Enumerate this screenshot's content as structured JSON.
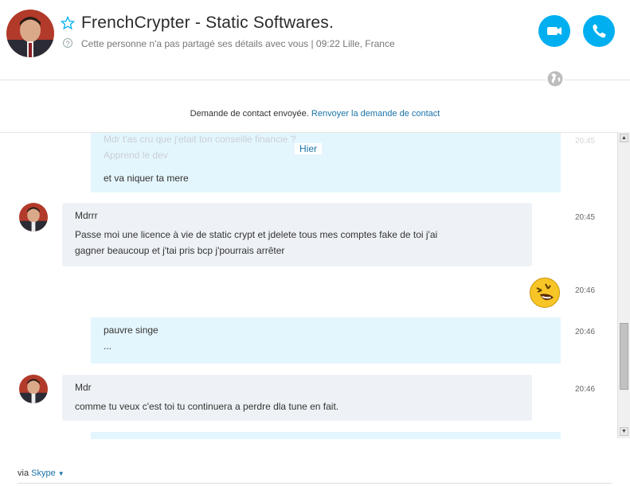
{
  "header": {
    "contact_name": "FrenchCrypter - Static Softwares.",
    "status_text": "Cette personne n'a pas partagé ses détails avec vous  |  09:22 Lille, France",
    "help_icon": "?"
  },
  "notice": {
    "text": "Demande de contact envoyée.",
    "link": "Renvoyer la demande de contact"
  },
  "conversation": {
    "faded_text_1": "Mdr t'as cru que j'etait ton conseille financie ?",
    "faded_text_2": "Apprend le dev",
    "faded_time": "20:45",
    "day_divider": "Hier",
    "messages": [
      {
        "from": "me",
        "lines": [
          "et va niquer ta mere"
        ],
        "time": ""
      },
      {
        "from": "them",
        "lines": [
          "Mdrrr",
          "Passe moi une licence à vie de static crypt et jdelete tous mes comptes fake de toi j'ai",
          "gagner beaucoup et j'tai pris bcp j'pourrais arrêter"
        ],
        "time": "20:45"
      },
      {
        "from": "me",
        "emoticon": "laugh-emoticon",
        "time": "20:46"
      },
      {
        "from": "me",
        "lines": [
          "pauvre singe",
          "..."
        ],
        "time": "20:46"
      },
      {
        "from": "them",
        "lines": [
          "Mdr",
          "comme tu veux c'est toi tu continuera a perdre dla tune en fait."
        ],
        "time": "20:46"
      }
    ]
  },
  "footer": {
    "via": "via",
    "service": "Skype"
  },
  "colors": {
    "accent": "#00aff0",
    "link": "#1a73a8",
    "my_bubble": "#e4f6fd",
    "their_bubble": "#eef2f6"
  }
}
